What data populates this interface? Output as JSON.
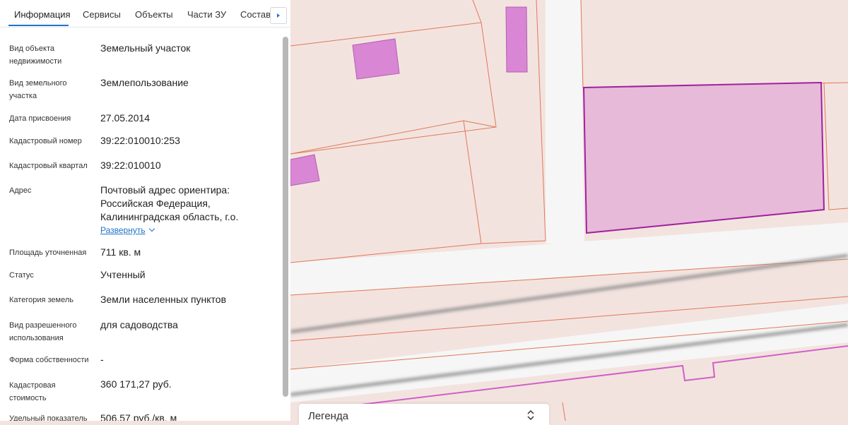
{
  "tabs": [
    {
      "label": "Информация"
    },
    {
      "label": "Сервисы"
    },
    {
      "label": "Объекты"
    },
    {
      "label": "Части ЗУ"
    },
    {
      "label": "Состав"
    }
  ],
  "fields": [
    {
      "label": "Вид объекта недвижимости",
      "value": "Земельный участок"
    },
    {
      "label": "Вид земельного участка",
      "value": "Землепользование"
    },
    {
      "label": "Дата присвоения",
      "value": "27.05.2014"
    },
    {
      "label": "Кадастровый номер",
      "value": "39:22:010010:253"
    },
    {
      "label": "Кадастровый квартал",
      "value": "39:22:010010"
    },
    {
      "label": "Адрес",
      "value": "Почтовый адрес ориентира: Российская Федерация, Калининградская область, г.о."
    },
    {
      "label": "Площадь уточненная",
      "value": "711 кв. м"
    },
    {
      "label": "Статус",
      "value": "Учтенный"
    },
    {
      "label": "Категория земель",
      "value": "Земли населенных пунктов"
    },
    {
      "label": "Вид разрешенного использования",
      "value": "для садоводства"
    },
    {
      "label": "Форма собственности",
      "value": "-"
    },
    {
      "label": "Кадастровая стоимость",
      "value": "360 171,27 руб."
    },
    {
      "label": "Удельный показатель",
      "value": "506,57 руб./кв. м"
    }
  ],
  "address_expand_label": "Развернуть",
  "legend": {
    "title": "Легенда"
  },
  "colors": {
    "accent": "#1e73c9",
    "parcel_fill": "#f3e3df",
    "parcel_border": "#e07856",
    "selected_fill": "#e6bad8",
    "selected_border": "#a020a0",
    "building": "#d986d4",
    "road": "#f6f6f6"
  },
  "icons": {
    "tabs_scroll": "chevron-right-icon",
    "expand": "chevron-down-icon",
    "legend_toggle": "expand-collapse-icon"
  }
}
